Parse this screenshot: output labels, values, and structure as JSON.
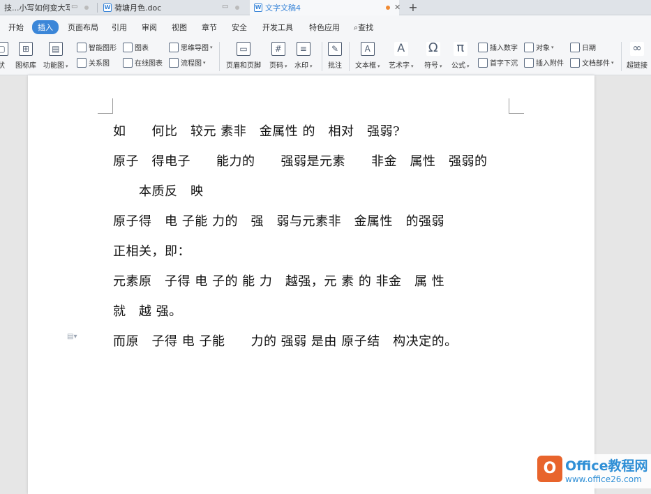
{
  "tabs": [
    {
      "label": "技...小写如何变大写"
    },
    {
      "label": "荷塘月色.doc"
    },
    {
      "label": "文字文稿4"
    }
  ],
  "menu": {
    "items": [
      "开始",
      "插入",
      "页面布局",
      "引用",
      "审阅",
      "视图",
      "章节",
      "安全",
      "开发工具",
      "特色应用",
      "查找"
    ],
    "active": "插入"
  },
  "ribbon": {
    "tubiaoku": "图标库",
    "gongneng": "功能图",
    "smart": "智能图形",
    "guanxi": "关系图",
    "chart": "图表",
    "online_chart": "在线图表",
    "mindmap": "思维导图",
    "flow": "流程图",
    "header_footer": "页眉和页脚",
    "pagenum": "页码",
    "watermark": "水印",
    "comment": "批注",
    "textbox": "文本框",
    "wordart": "艺术字",
    "symbol": "符号",
    "formula": "公式",
    "insert_number": "插入数字",
    "dropcap": "首字下沉",
    "object": "对象",
    "attachment": "插入附件",
    "date": "日期",
    "docparts": "文档部件",
    "hyperlink": "超链接",
    "left_cut": "状"
  },
  "document": {
    "lines": [
      "如　　何比　较元 素非　金属性 的　相对　强弱?",
      "原子　得电子　　能力的　　强弱是元素　　非金　属性　强弱的",
      "　　本质反　映",
      "原子得　电 子能 力的　强　弱与元素非　金属性　的强弱",
      "正相关，即：",
      "元素原　子得 电 子的 能 力　越强，元 素 的 非金　属 性",
      "就　越 强。",
      "而原　子得 电 子能　　力的 强弱 是由 原子结　构决定的。"
    ]
  },
  "watermark": {
    "logo_letter": "O",
    "brand": "Office教程网",
    "url": "www.office26.com"
  },
  "colors": {
    "accent": "#3b86d8",
    "watermark_orange": "#e8642c",
    "watermark_blue": "#2f8fd6"
  }
}
